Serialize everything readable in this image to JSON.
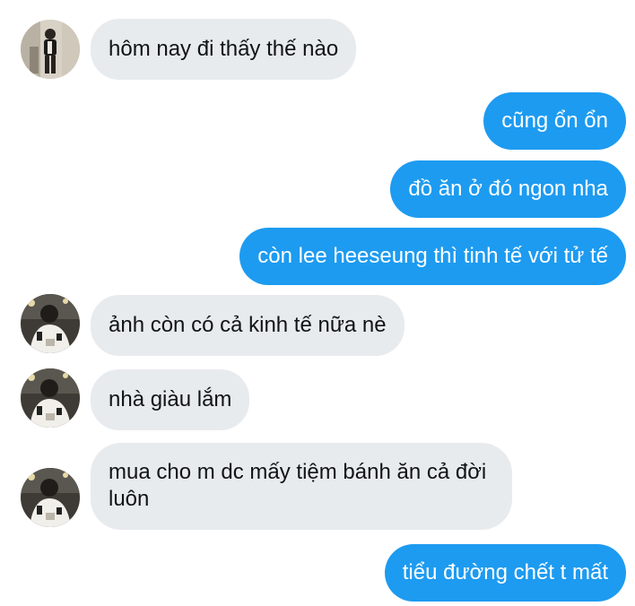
{
  "messages": [
    {
      "direction": "incoming",
      "avatar_icon": "profile-photo-standing",
      "text": "hôm nay đi thấy thế nào"
    },
    {
      "direction": "outgoing",
      "text": "cũng ổn ổn"
    },
    {
      "direction": "outgoing",
      "text": "đồ ăn ở đó ngon nha"
    },
    {
      "direction": "outgoing",
      "text": "còn lee heeseung thì tinh tế với tử tế"
    },
    {
      "direction": "incoming",
      "avatar_icon": "profile-photo-jacket",
      "text": "ảnh còn có cả kinh tế nữa nè"
    },
    {
      "direction": "incoming",
      "avatar_icon": "profile-photo-jacket",
      "text": "nhà giàu lắm"
    },
    {
      "direction": "incoming",
      "avatar_icon": "profile-photo-jacket",
      "text": "mua cho m dc mấy tiệm bánh ăn cả đời luôn"
    },
    {
      "direction": "outgoing",
      "text": "tiểu đường chết t mất"
    }
  ],
  "colors": {
    "outgoing_bubble": "#1d9bf0",
    "incoming_bubble": "#e8ebee",
    "outgoing_text": "#ffffff",
    "incoming_text": "#111417"
  }
}
